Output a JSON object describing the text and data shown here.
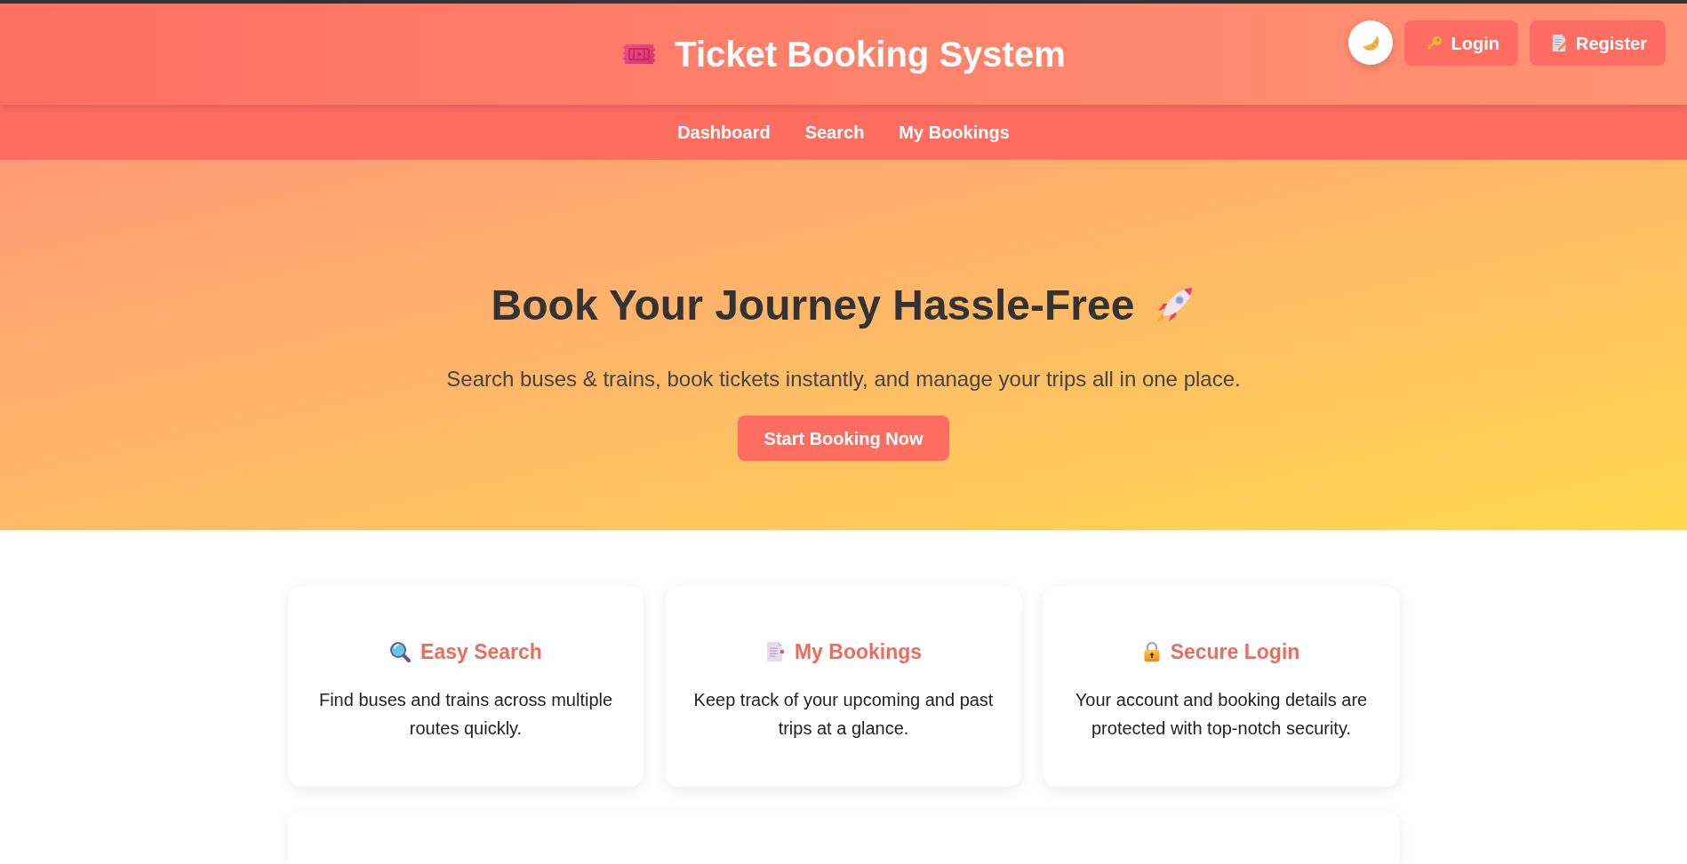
{
  "header": {
    "title": "Ticket Booking System",
    "actions": [
      {
        "label": "Login"
      },
      {
        "label": "Register"
      }
    ]
  },
  "nav": [
    {
      "label": "Dashboard"
    },
    {
      "label": "Search"
    },
    {
      "label": "My Bookings"
    }
  ],
  "hero": {
    "title": "Book Your Journey Hassle-Free",
    "subtitle": "Search buses & trains, book tickets instantly, and manage your trips all in one place.",
    "button": "Start Booking Now"
  },
  "features": [
    {
      "title": "Easy Search",
      "description": "Find buses and trains across multiple routes quickly."
    },
    {
      "title": "My Bookings",
      "description": "Keep track of your upcoming and past trips at a glance."
    },
    {
      "title": "Secure Login",
      "description": "Your account and booking details are protected with top-notch security."
    }
  ]
}
